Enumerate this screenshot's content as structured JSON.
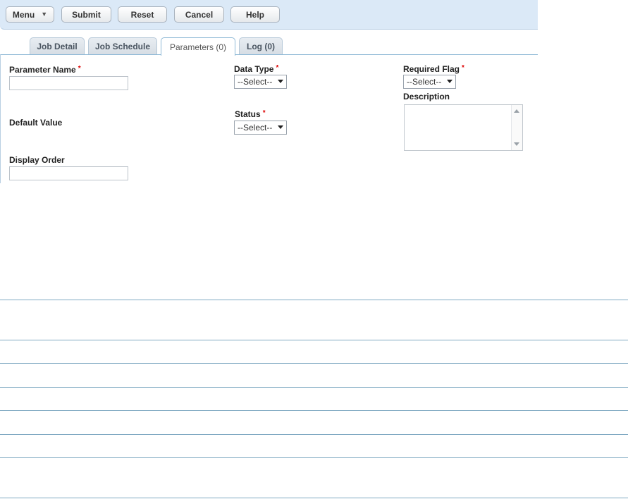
{
  "toolbar": {
    "menu_label": "Menu",
    "submit_label": "Submit",
    "reset_label": "Reset",
    "cancel_label": "Cancel",
    "help_label": "Help"
  },
  "tabs": [
    {
      "label": "Job Detail",
      "active": false
    },
    {
      "label": "Job Schedule",
      "active": false
    },
    {
      "label": "Parameters (0)",
      "active": true
    },
    {
      "label": "Log (0)",
      "active": false
    }
  ],
  "form": {
    "parameter_name": {
      "label": "Parameter Name",
      "required": "*",
      "value": ""
    },
    "default_value": {
      "label": "Default Value"
    },
    "display_order": {
      "label": "Display Order",
      "value": ""
    },
    "data_type": {
      "label": "Data Type",
      "required": "*",
      "value": "--Select--"
    },
    "status": {
      "label": "Status",
      "required": "*",
      "value": "--Select--"
    },
    "required_flag": {
      "label": "Required Flag",
      "required": "*",
      "value": "--Select--"
    },
    "description": {
      "label": "Description",
      "value": ""
    }
  },
  "colors": {
    "toolbar_bg": "#dbe9f7",
    "required_star": "#dd0000",
    "divider": "#7fa9c2"
  }
}
